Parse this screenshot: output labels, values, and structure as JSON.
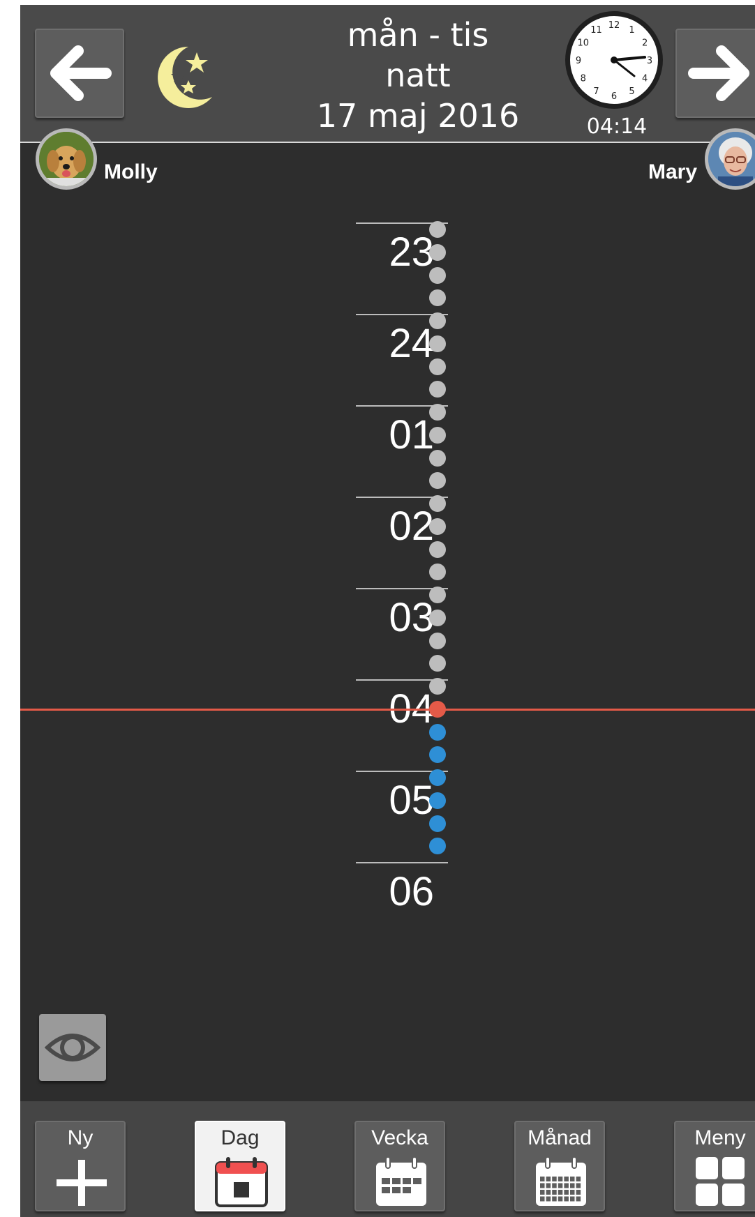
{
  "header": {
    "day_range": "mån - tis",
    "period": "natt",
    "date": "17 maj 2016",
    "clock_time": "04:14",
    "clock_numbers": [
      "12",
      "1",
      "2",
      "3",
      "4",
      "5",
      "6",
      "7",
      "8",
      "9",
      "10",
      "11"
    ],
    "prev_icon": "arrow-left-icon",
    "next_icon": "arrow-right-icon",
    "period_icon": "moon-stars-icon"
  },
  "users": {
    "left": {
      "name": "Molly"
    },
    "right": {
      "name": "Mary"
    }
  },
  "timeline": {
    "hours": [
      "23",
      "24",
      "01",
      "02",
      "03",
      "04",
      "05",
      "06"
    ],
    "current_hour": "04",
    "past_dot_color": "#bdbdbd",
    "now_dot_color": "#e45a48",
    "future_dot_color": "#2e8fd6",
    "now_line_color": "#e45a48"
  },
  "view_toggle": {
    "icon": "eye-icon"
  },
  "toolbar": {
    "buttons": [
      {
        "label": "Ny",
        "icon": "plus-icon"
      },
      {
        "label": "Dag",
        "icon": "day-calendar-icon",
        "active": true
      },
      {
        "label": "Vecka",
        "icon": "week-calendar-icon"
      },
      {
        "label": "Månad",
        "icon": "month-calendar-icon"
      },
      {
        "label": "Meny",
        "icon": "menu-grid-icon"
      }
    ]
  }
}
